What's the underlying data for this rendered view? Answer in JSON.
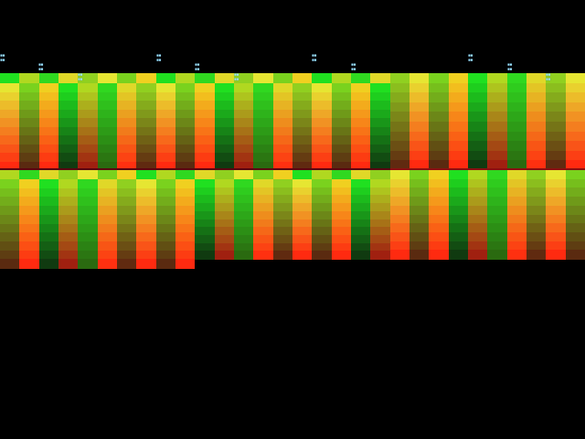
{
  "colors": {
    "background": "#000000",
    "band_light": "#e8e830",
    "band_green": "#20e020",
    "band_red": "#ff2020",
    "band_dark": "#700010",
    "marker_text": "#9fe8ff"
  },
  "visual_elements": [
    "gradient-band-upper",
    "gradient-band-lower",
    "dark-red-divider-line",
    "cyan-tick-markers"
  ],
  "markers": [
    {
      "id": "m1",
      "lines": [
        "▪▪",
        "▪▪"
      ]
    },
    {
      "id": "m2",
      "lines": [
        "▪▪",
        "▪▪"
      ]
    },
    {
      "id": "m3",
      "lines": [
        "▪▪",
        "▪▪"
      ]
    },
    {
      "id": "m4",
      "lines": [
        "▪▪",
        "▪▪"
      ]
    },
    {
      "id": "m5",
      "lines": [
        "▪▪",
        "▪▪"
      ]
    },
    {
      "id": "m6",
      "lines": [
        "▪▪",
        "▪▪"
      ]
    },
    {
      "id": "m7",
      "lines": [
        "▪▪",
        "▪▪"
      ]
    },
    {
      "id": "m8",
      "lines": [
        "▪▪",
        "▪▪"
      ]
    },
    {
      "id": "m9",
      "lines": [
        "▪▪",
        "▪▪"
      ]
    },
    {
      "id": "m10",
      "lines": [
        "▪▪",
        "▪▪"
      ]
    },
    {
      "id": "m11",
      "lines": [
        "▪▪",
        "▪▪"
      ]
    }
  ]
}
